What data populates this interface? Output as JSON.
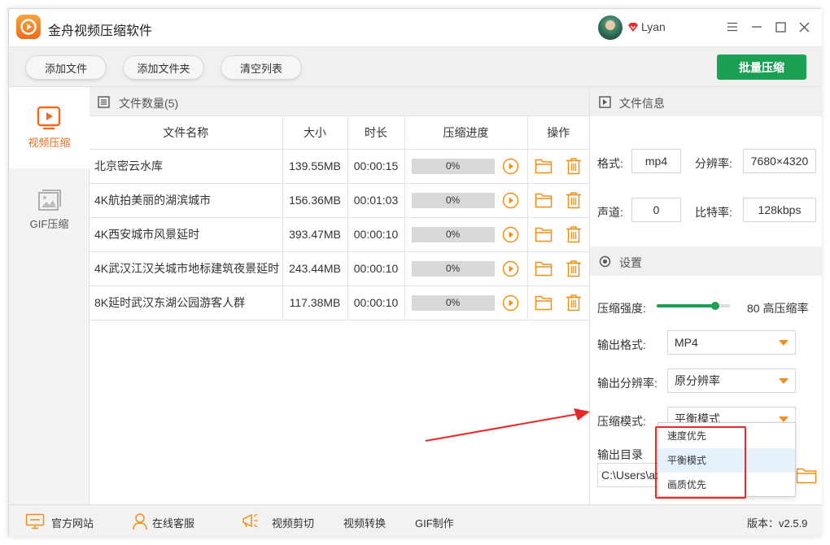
{
  "app": {
    "title": "金舟视频压缩软件",
    "username": "Lyan"
  },
  "toolbar": {
    "add_file": "添加文件",
    "add_folder": "添加文件夹",
    "clear_list": "清空列表",
    "batch": "批量压缩"
  },
  "sidebar": {
    "items": [
      {
        "label": "视频压缩",
        "active": true
      },
      {
        "label": "GIF压缩",
        "active": false
      }
    ]
  },
  "files": {
    "count_label": "文件数量(5)",
    "columns": {
      "name": "文件名称",
      "size": "大小",
      "duration": "时长",
      "progress": "压缩进度",
      "ops": "操作"
    },
    "rows": [
      {
        "name": "北京密云水库",
        "size": "139.55MB",
        "duration": "00:00:15",
        "progress": "0%"
      },
      {
        "name": "4K航拍美丽的湖滨城市",
        "size": "156.36MB",
        "duration": "00:01:03",
        "progress": "0%"
      },
      {
        "name": "4K西安城市风景延时",
        "size": "393.47MB",
        "duration": "00:00:10",
        "progress": "0%"
      },
      {
        "name": "4K武汉江汉关城市地标建筑夜景延时",
        "size": "243.44MB",
        "duration": "00:00:10",
        "progress": "0%"
      },
      {
        "name": "8K延时武汉东湖公园游客人群",
        "size": "117.38MB",
        "duration": "00:00:10",
        "progress": "0%"
      }
    ]
  },
  "info": {
    "title": "文件信息",
    "format_label": "格式:",
    "format": "mp4",
    "resolution_label": "分辨率:",
    "resolution": "7680×4320",
    "channel_label": "声道:",
    "channel": "0",
    "bitrate_label": "比特率:",
    "bitrate": "128kbps"
  },
  "settings": {
    "title": "设置",
    "strength_label": "压缩强度:",
    "strength_value": 80,
    "strength_text": "80 高压缩率",
    "out_format_label": "输出格式:",
    "out_format": "MP4",
    "out_res_label": "输出分辨率:",
    "out_res": "原分辨率",
    "mode_label": "压缩模式:",
    "mode": "平衡模式",
    "mode_options": [
      "速度优先",
      "平衡模式",
      "画质优先"
    ],
    "out_dir_label": "输出目录",
    "out_dir": "C:\\Users\\adm"
  },
  "statusbar": {
    "website": "官方网站",
    "support": "在线客服",
    "edit": "视频剪切",
    "convert": "视频转换",
    "gif": "GIF制作",
    "version": "版本：v2.5.9"
  },
  "colors": {
    "accent": "#1aa052",
    "orange": "#f09018",
    "annotation": "#e8292a"
  }
}
